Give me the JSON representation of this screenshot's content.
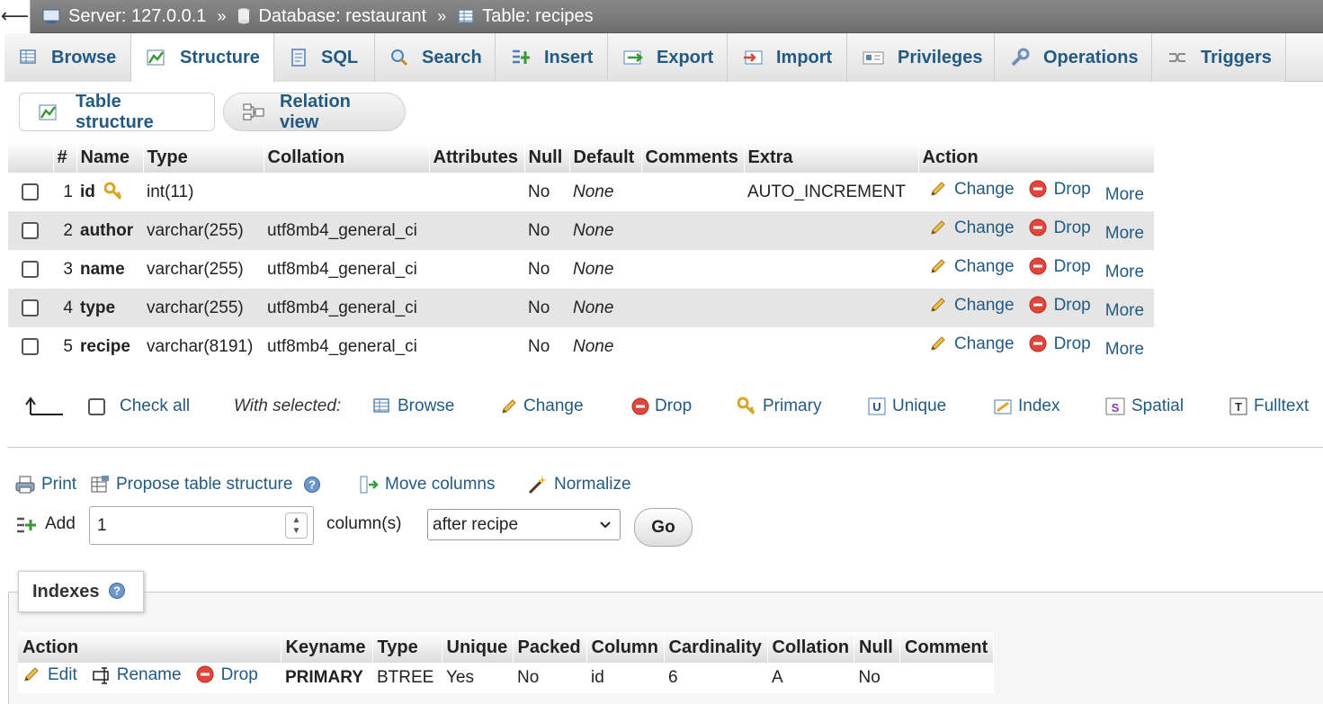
{
  "breadcrumb": {
    "server": "Server: 127.0.0.1",
    "database": "Database: restaurant",
    "table": "Table: recipes",
    "separator": "»"
  },
  "tabs": [
    "Browse",
    "Structure",
    "SQL",
    "Search",
    "Insert",
    "Export",
    "Import",
    "Privileges",
    "Operations",
    "Triggers"
  ],
  "active_tab": "Structure",
  "subtabs": {
    "table_structure": "Table structure",
    "relation_view": "Relation view"
  },
  "structure": {
    "headers": [
      "#",
      "Name",
      "Type",
      "Collation",
      "Attributes",
      "Null",
      "Default",
      "Comments",
      "Extra",
      "Action"
    ],
    "rows": [
      {
        "num": "1",
        "name": "id",
        "type": "int(11)",
        "collation": "",
        "attributes": "",
        "null": "No",
        "default": "None",
        "comments": "",
        "extra": "AUTO_INCREMENT"
      },
      {
        "num": "2",
        "name": "author",
        "type": "varchar(255)",
        "collation": "utf8mb4_general_ci",
        "attributes": "",
        "null": "No",
        "default": "None",
        "comments": "",
        "extra": ""
      },
      {
        "num": "3",
        "name": "name",
        "type": "varchar(255)",
        "collation": "utf8mb4_general_ci",
        "attributes": "",
        "null": "No",
        "default": "None",
        "comments": "",
        "extra": ""
      },
      {
        "num": "4",
        "name": "type",
        "type": "varchar(255)",
        "collation": "utf8mb4_general_ci",
        "attributes": "",
        "null": "No",
        "default": "None",
        "comments": "",
        "extra": ""
      },
      {
        "num": "5",
        "name": "recipe",
        "type": "varchar(8191)",
        "collation": "utf8mb4_general_ci",
        "attributes": "",
        "null": "No",
        "default": "None",
        "comments": "",
        "extra": ""
      }
    ],
    "actions": {
      "change": "Change",
      "drop": "Drop",
      "more": "More"
    }
  },
  "selection": {
    "check_all": "Check all",
    "with_selected": "With selected:",
    "buttons": [
      "Browse",
      "Change",
      "Drop",
      "Primary",
      "Unique",
      "Index",
      "Spatial",
      "Fulltext"
    ]
  },
  "tools": {
    "print": "Print",
    "propose": "Propose table structure",
    "move_columns": "Move columns",
    "normalize": "Normalize"
  },
  "add_columns": {
    "label": "Add",
    "count": "1",
    "unit": "column(s)",
    "position": "after recipe",
    "go": "Go"
  },
  "indexes": {
    "legend": "Indexes",
    "headers": [
      "Action",
      "Keyname",
      "Type",
      "Unique",
      "Packed",
      "Column",
      "Cardinality",
      "Collation",
      "Null",
      "Comment"
    ],
    "actions": {
      "edit": "Edit",
      "rename": "Rename",
      "drop": "Drop"
    },
    "rows": [
      {
        "keyname": "PRIMARY",
        "type": "BTREE",
        "unique": "Yes",
        "packed": "No",
        "column": "id",
        "cardinality": "6",
        "collation": "A",
        "null": "No",
        "comment": ""
      }
    ]
  },
  "colors": {
    "link": "#235a81",
    "drop_icon": "#e0463c",
    "pencil": "#e0a93a",
    "key": "#d9a526"
  }
}
